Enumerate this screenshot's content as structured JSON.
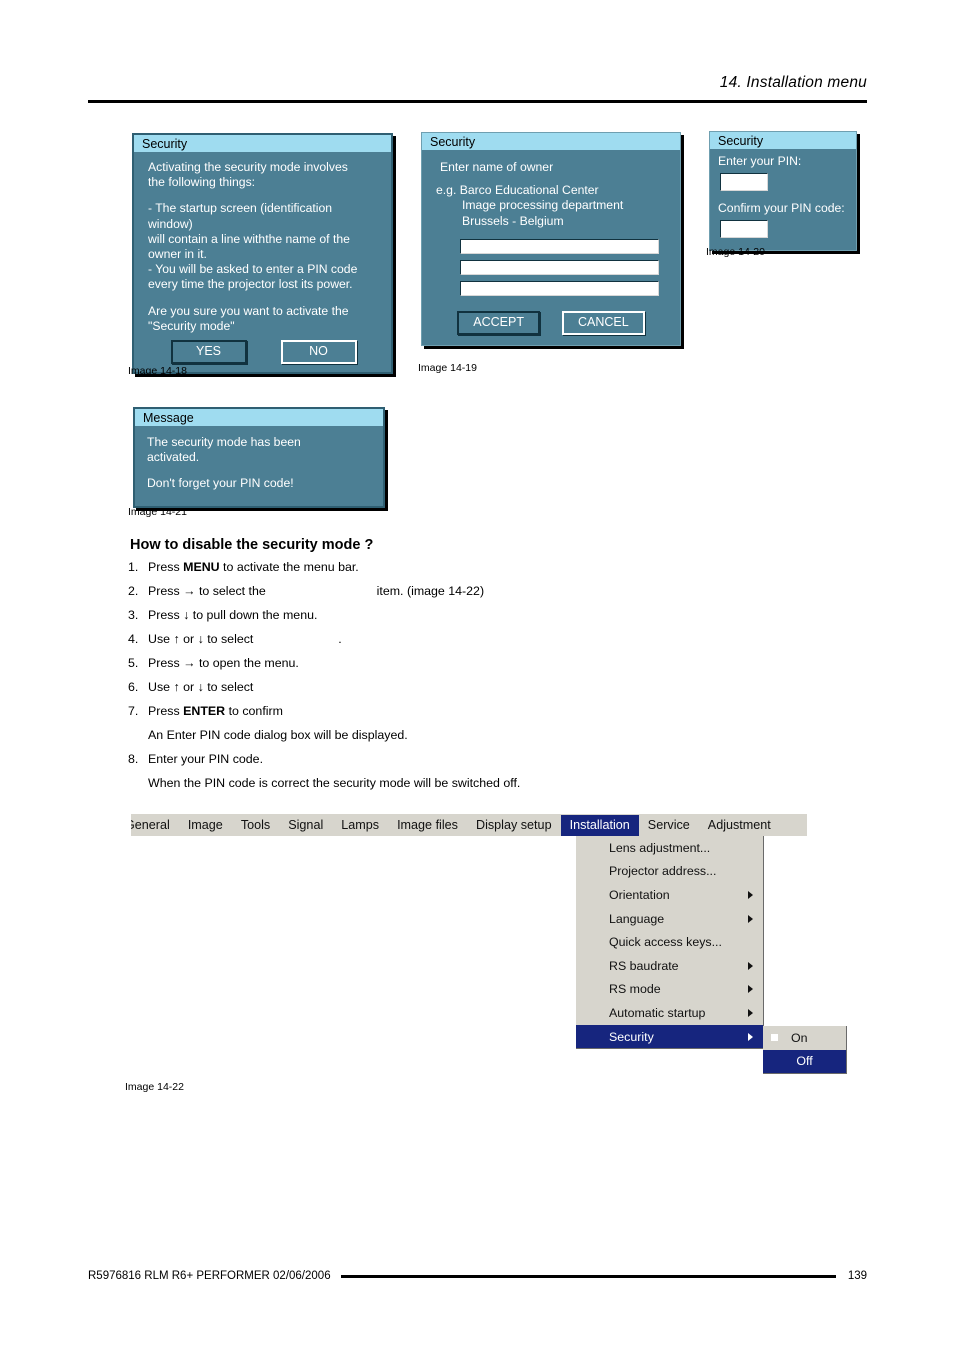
{
  "header": {
    "title": "14.  Installation menu"
  },
  "dialog_security_activate": {
    "title": "Security",
    "line1": "Activating the security mode involves",
    "line2": "the following things:",
    "line3": "- The startup screen (identification window)",
    "line4": "will contain a line withthe name of the",
    "line5": "owner in it.",
    "line6": "- You will be asked to enter a PIN code",
    "line7": "every time the projector lost its power.",
    "line8": "Are you sure you want to activate the",
    "line9": "\"Security mode\"",
    "yes_label": "YES",
    "no_label": "NO",
    "caption": "Image 14-18"
  },
  "dialog_owner_name": {
    "title": "Security",
    "prompt": "Enter name of owner",
    "example1": "e.g. Barco Educational Center",
    "example2": "Image processing department",
    "example3": "Brussels - Belgium",
    "field1": "",
    "field2": "",
    "field3": "",
    "accept_label": "ACCEPT",
    "cancel_label": "CANCEL",
    "caption": "Image 14-19"
  },
  "dialog_pin": {
    "title": "Security",
    "enter_label": "Enter your PIN:",
    "confirm_label": "Confirm your PIN code:",
    "pin_value": "",
    "confirm_value": "",
    "caption": "Image 14-20"
  },
  "dialog_message": {
    "title": "Message",
    "line1": "The security mode has been",
    "line2": "activated.",
    "line3": "Don't forget your PIN code!",
    "caption": "Image 14-21"
  },
  "section": {
    "heading": "How to disable the security mode ?",
    "steps": [
      {
        "num": "1.",
        "pre": "Press ",
        "bold": "MENU",
        "post": " to activate the menu bar."
      },
      {
        "num": "2.",
        "pre": "Press → to select the ",
        "bold": "",
        "post": " item.  (image 14-22)"
      },
      {
        "num": "3.",
        "pre": "Press ↓ to pull down the menu.",
        "bold": "",
        "post": ""
      },
      {
        "num": "4.",
        "pre": "Use ↑ or ↓ to select ",
        "bold": "",
        "post": " ."
      },
      {
        "num": "5.",
        "pre": "Press → to open the menu.",
        "bold": "",
        "post": ""
      },
      {
        "num": "6.",
        "pre": "Use ↑ or ↓ to select ",
        "bold": "",
        "post": ""
      },
      {
        "num": "7.",
        "pre": "Press ",
        "bold": "ENTER",
        "post": " to confirm"
      },
      {
        "num": "",
        "pre": "An Enter PIN code dialog box will be displayed.",
        "bold": "",
        "post": ""
      },
      {
        "num": "8.",
        "pre": "Enter your PIN code.",
        "bold": "",
        "post": ""
      },
      {
        "num": "",
        "pre": "When the PIN code is correct the security mode will be switched off.",
        "bold": "",
        "post": ""
      }
    ]
  },
  "menu_screenshot": {
    "caption": "Image 14-22",
    "menubar": [
      {
        "label": "General",
        "active": false,
        "clipped": true
      },
      {
        "label": "Image",
        "active": false
      },
      {
        "label": "Tools",
        "active": false
      },
      {
        "label": "Signal",
        "active": false
      },
      {
        "label": "Lamps",
        "active": false
      },
      {
        "label": "Image files",
        "active": false
      },
      {
        "label": "Display setup",
        "active": false
      },
      {
        "label": "Installation",
        "active": true
      },
      {
        "label": "Service",
        "active": false
      },
      {
        "label": "Adjustment",
        "active": false
      }
    ],
    "dropdown": [
      {
        "label": "Lens adjustment...",
        "arrow": false,
        "active": false
      },
      {
        "label": "Projector address...",
        "arrow": false,
        "active": false
      },
      {
        "label": "Orientation",
        "arrow": true,
        "active": false
      },
      {
        "label": "Language",
        "arrow": true,
        "active": false
      },
      {
        "label": "Quick access keys...",
        "arrow": false,
        "active": false
      },
      {
        "label": "RS baudrate",
        "arrow": true,
        "active": false
      },
      {
        "label": "RS mode",
        "arrow": true,
        "active": false
      },
      {
        "label": "Automatic startup",
        "arrow": true,
        "active": false
      },
      {
        "label": "Security",
        "arrow": true,
        "active": true
      }
    ],
    "submenu": [
      {
        "label": "On",
        "active": false,
        "marked": true
      },
      {
        "label": "Off",
        "active": true,
        "marked": false
      }
    ]
  },
  "footer": {
    "left": "R5976816   RLM R6+ PERFORMER  02/06/2006",
    "page": "139"
  },
  "colors": {
    "osd_body": "#4c7f94",
    "osd_title": "#9fdcf0",
    "menu_bg": "#d7d5cd",
    "menu_highlight": "#16257e"
  }
}
